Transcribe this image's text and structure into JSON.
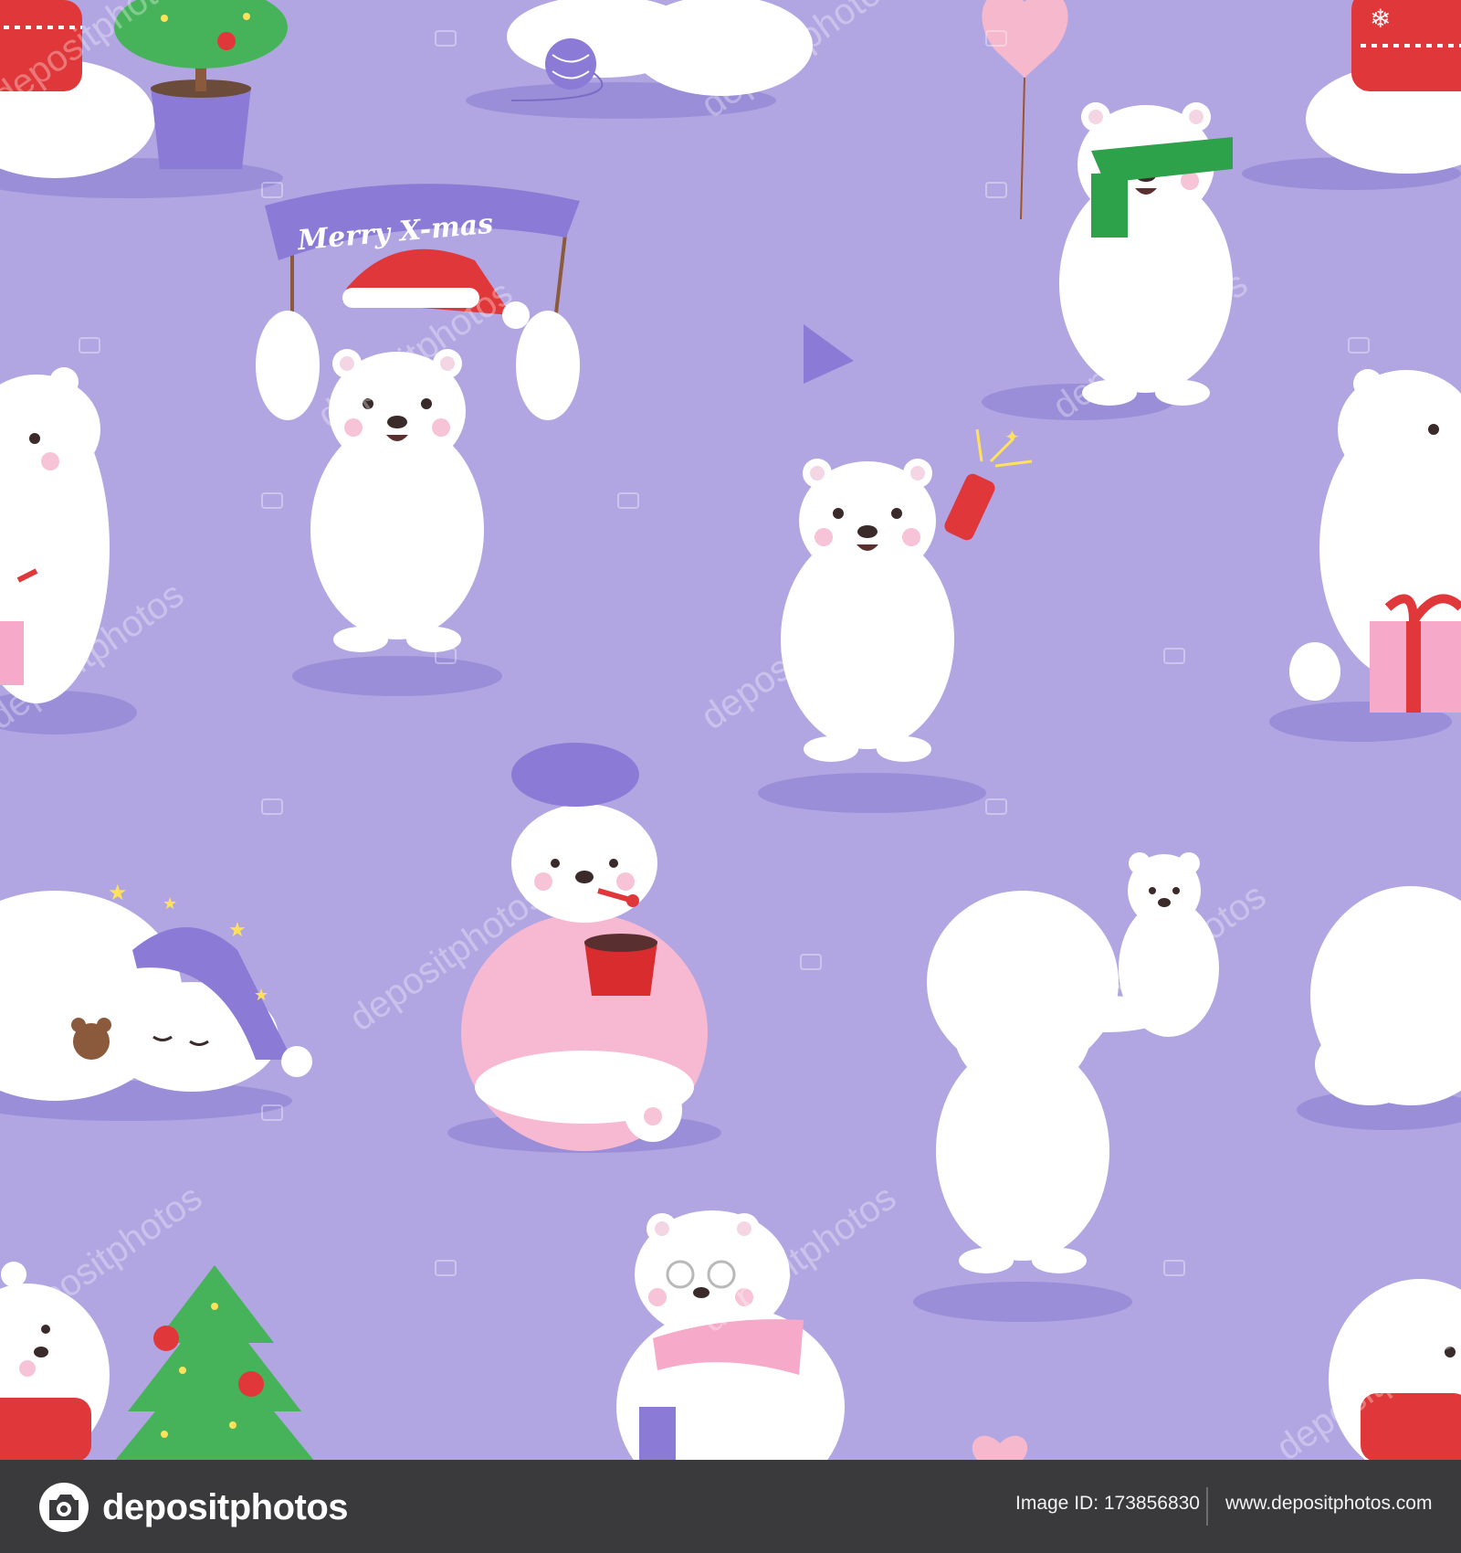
{
  "banner": {
    "text": "Merry X-mas"
  },
  "watermark": {
    "text": "depositphotos"
  },
  "footer": {
    "brand_name": "depositphotos",
    "image_id": "Image ID: 173856830",
    "site_url": "www.depositphotos.com"
  },
  "colors": {
    "background": "#b2a6e2",
    "footer_background": "#3a3a3c",
    "bear_white": "#ffffff",
    "shadow": "#9185d3",
    "santa_red": "#e0383a",
    "scarf_green": "#2ea24a",
    "blanket_pink": "#f7b8d2",
    "hat_purple": "#8b7bd6",
    "tree_green": "#46b35a"
  },
  "illustration": {
    "subjects": [
      "bear-in-sweater-with-potted-tree",
      "sleeping-bear-with-yarn-ball",
      "bear-with-heart-balloon-and-scarf",
      "bear-in-red-sweater",
      "bear-holding-merry-xmas-banner",
      "bear-with-party-hat-and-cracker",
      "bear-with-gift",
      "sick-bear-in-blanket",
      "sleeping-bear-with-teddy",
      "bear-holding-cub",
      "bear-with-christmas-tree",
      "knitting-bear-with-glasses"
    ]
  }
}
